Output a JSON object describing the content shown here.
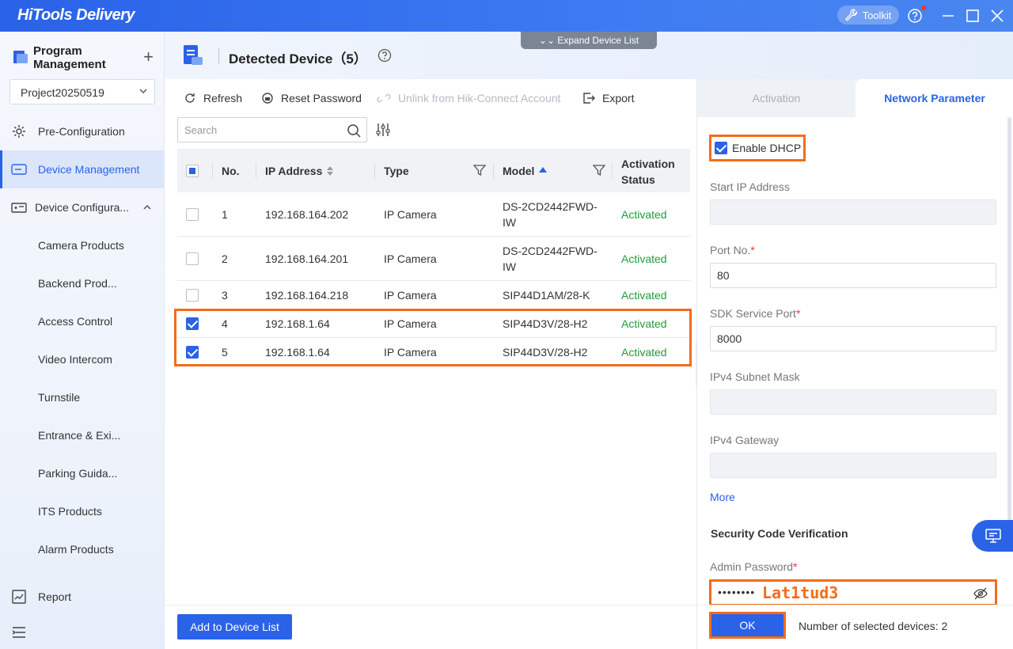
{
  "app": {
    "title": "HiTools Delivery",
    "toolkit_label": "Toolkit"
  },
  "sidebar": {
    "program_management_label": "Program Management",
    "project_select": "Project20250519",
    "items": [
      {
        "label": "Pre-Configuration",
        "icon": "gear-icon"
      },
      {
        "label": "Device Management",
        "icon": "device-icon"
      },
      {
        "label": "Device Configura...",
        "icon": "device-config-icon"
      },
      {
        "label": "Camera Products"
      },
      {
        "label": "Backend Prod..."
      },
      {
        "label": "Access Control"
      },
      {
        "label": "Video Intercom"
      },
      {
        "label": "Turnstile"
      },
      {
        "label": "Entrance & Exi..."
      },
      {
        "label": "Parking Guida..."
      },
      {
        "label": "ITS Products"
      },
      {
        "label": "Alarm Products"
      },
      {
        "label": "Report",
        "icon": "report-icon"
      }
    ]
  },
  "header": {
    "title": "Detected Device（5）",
    "expand_label": "Expand Device List"
  },
  "toolbar": {
    "refresh": "Refresh",
    "reset_password": "Reset Password",
    "unlink": "Unlink from Hik-Connect Account",
    "export": "Export"
  },
  "search": {
    "placeholder": "Search"
  },
  "table": {
    "headers": {
      "no": "No.",
      "ip": "IP Address",
      "type": "Type",
      "model": "Model",
      "activation1": "Activation",
      "activation2": "Status"
    },
    "rows": [
      {
        "no": "1",
        "ip": "192.168.164.202",
        "type": "IP Camera",
        "model1": "DS-2CD2442FWD-",
        "model2": "IW",
        "status": "Activated",
        "checked": false
      },
      {
        "no": "2",
        "ip": "192.168.164.201",
        "type": "IP Camera",
        "model1": "DS-2CD2442FWD-",
        "model2": "IW",
        "status": "Activated",
        "checked": false
      },
      {
        "no": "3",
        "ip": "192.168.164.218",
        "type": "IP Camera",
        "model1": "SIP44D1AM/28-K",
        "model2": "",
        "status": "Activated",
        "checked": false
      },
      {
        "no": "4",
        "ip": "192.168.1.64",
        "type": "IP Camera",
        "model1": "SIP44D3V/28-H2",
        "model2": "",
        "status": "Activated",
        "checked": true
      },
      {
        "no": "5",
        "ip": "192.168.1.64",
        "type": "IP Camera",
        "model1": "SIP44D3V/28-H2",
        "model2": "",
        "status": "Activated",
        "checked": true
      }
    ]
  },
  "add_button": "Add to Device List",
  "panel": {
    "tab_activation": "Activation",
    "tab_network": "Network Parameter",
    "enable_dhcp": "Enable DHCP",
    "start_ip_label": "Start IP Address",
    "start_ip_value": "",
    "port_label": "Port No.",
    "port_value": "80",
    "sdk_label": "SDK Service Port",
    "sdk_value": "8000",
    "mask_label": "IPv4 Subnet Mask",
    "gateway_label": "IPv4 Gateway",
    "more": "More",
    "security_title": "Security Code Verification",
    "admin_pwd_label": "Admin Password",
    "admin_pwd_dots": "••••••••",
    "admin_pwd_annotation": "Lat1tud3",
    "ok": "OK",
    "selected_count": "Number of selected devices: 2",
    "required_mark": "*"
  },
  "colors": {
    "accent": "#2a62e8",
    "highlight": "#f36c1a",
    "activated": "#1f9c3b"
  }
}
